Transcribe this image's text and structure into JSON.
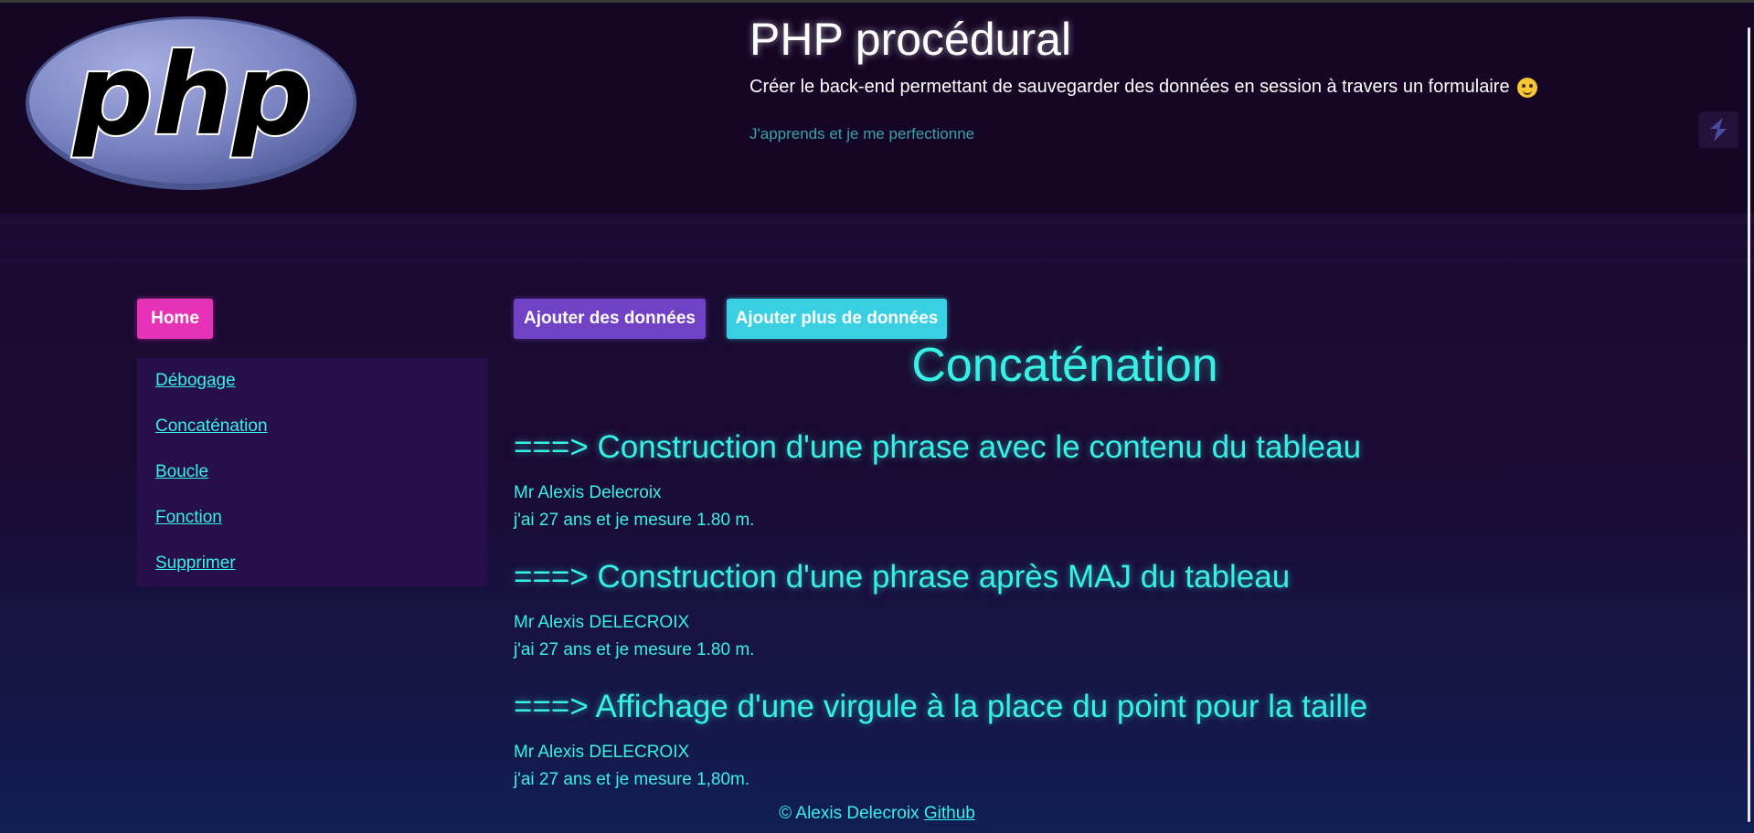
{
  "header": {
    "logo_text": "php",
    "title": "PHP procédural",
    "description": "Créer le back-end permettant de sauvegarder des données en session à travers un formulaire",
    "tagline": "J'apprends et je me perfectionne"
  },
  "sidebar": {
    "home_label": "Home",
    "items": [
      {
        "label": "Débogage"
      },
      {
        "label": "Concaténation"
      },
      {
        "label": "Boucle"
      },
      {
        "label": "Fonction"
      },
      {
        "label": "Supprimer"
      }
    ]
  },
  "actions": {
    "add_data_label": "Ajouter des données",
    "add_more_data_label": "Ajouter plus de données"
  },
  "main": {
    "title": "Concaténation",
    "sections": [
      {
        "heading": "===> Construction d'une phrase avec le contenu du tableau",
        "line1": "Mr Alexis Delecroix",
        "line2": "j'ai 27 ans et je mesure 1.80 m."
      },
      {
        "heading": "===> Construction d'une phrase après MAJ du tableau",
        "line1": "Mr Alexis DELECROIX",
        "line2": "j'ai 27 ans et je mesure 1.80 m."
      },
      {
        "heading": "===> Affichage d'une virgule à la place du point pour la taille",
        "line1": "Mr Alexis DELECROIX",
        "line2": "j'ai 27 ans et je mesure 1,80m."
      }
    ]
  },
  "footer": {
    "copyright": "© Alexis Delecroix",
    "github_label": "Github"
  },
  "colors": {
    "accent_cyan": "#36f1e6",
    "home_pink": "#e532b6",
    "button_purple": "#7242c6",
    "button_cyan": "#3ad0e3",
    "background": "#1a0a2e"
  },
  "icons": {
    "description_emoji": "smiley-icon",
    "customizer": "customizer-icon"
  }
}
